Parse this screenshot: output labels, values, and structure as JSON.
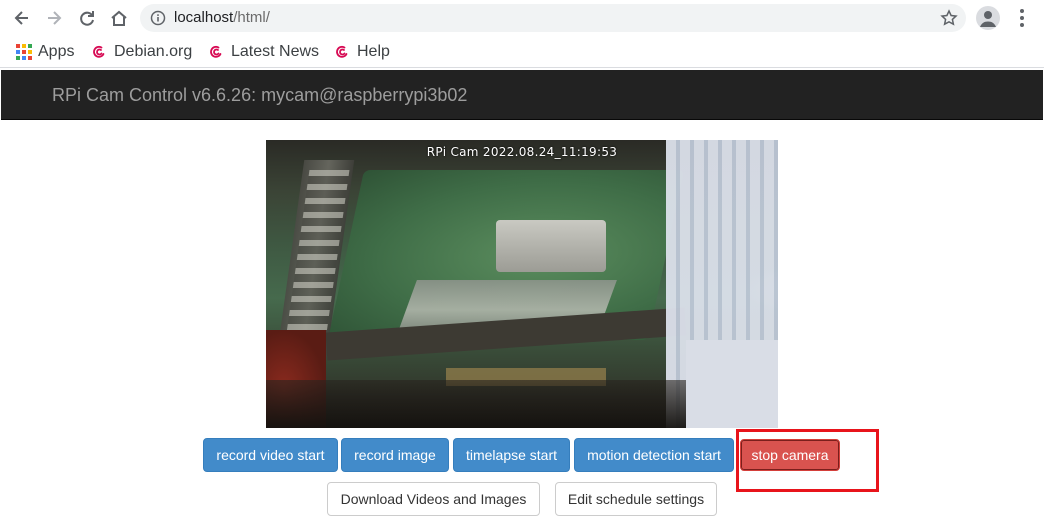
{
  "browser": {
    "url_host": "localhost",
    "url_path": "/html/",
    "bookmarks": [
      {
        "label": "Apps"
      },
      {
        "label": "Debian.org"
      },
      {
        "label": "Latest News"
      },
      {
        "label": "Help"
      }
    ]
  },
  "navbar": {
    "brand": "RPi Cam Control v6.6.26: mycam@raspberrypi3b02"
  },
  "preview": {
    "annotation": "RPi Cam 2022.08.24_11:19:53"
  },
  "buttons": {
    "record_video": "record video start",
    "record_image": "record image",
    "timelapse": "timelapse start",
    "motion_detection": "motion detection start",
    "stop_camera": "stop camera",
    "download": "Download Videos and Images",
    "schedule": "Edit schedule settings"
  },
  "colors": {
    "navbar_bg": "#222222",
    "primary": "#428bca",
    "danger": "#d9534f",
    "highlight": "#e8141b"
  }
}
